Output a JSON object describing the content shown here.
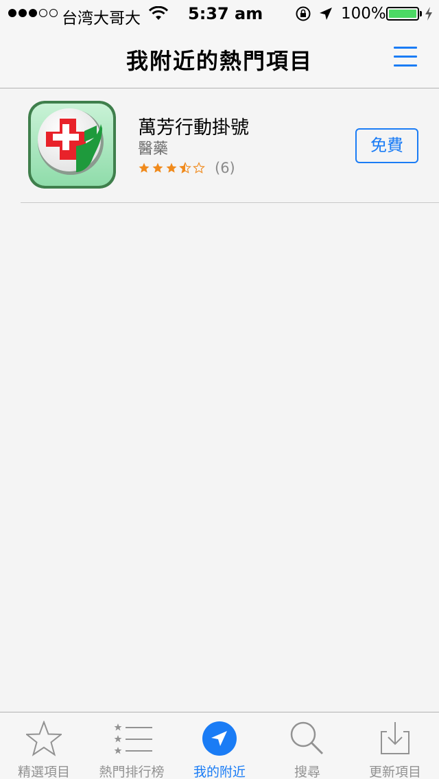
{
  "status_bar": {
    "carrier": "台湾大哥大",
    "time": "5:37 am",
    "battery_percent": "100%",
    "signal_bars_filled": 3,
    "signal_bars_total": 5
  },
  "nav": {
    "title": "我附近的熱門項目",
    "menu_icon": "list-icon"
  },
  "apps": [
    {
      "name": "萬芳行動掛號",
      "category": "醫藥",
      "rating": 3.5,
      "rating_count": "(6)",
      "action_label": "免費",
      "icon": "hospital-cross-icon"
    }
  ],
  "tabs": [
    {
      "label": "精選項目",
      "icon": "star-icon",
      "active": false
    },
    {
      "label": "熱門排行榜",
      "icon": "ranked-list-icon",
      "active": false
    },
    {
      "label": "我的附近",
      "icon": "location-arrow-icon",
      "active": true
    },
    {
      "label": "搜尋",
      "icon": "search-icon",
      "active": false
    },
    {
      "label": "更新項目",
      "icon": "download-tray-icon",
      "active": false
    }
  ],
  "colors": {
    "accent": "#1a7cf5",
    "star": "#f08a1c",
    "battery": "#4cd964"
  }
}
